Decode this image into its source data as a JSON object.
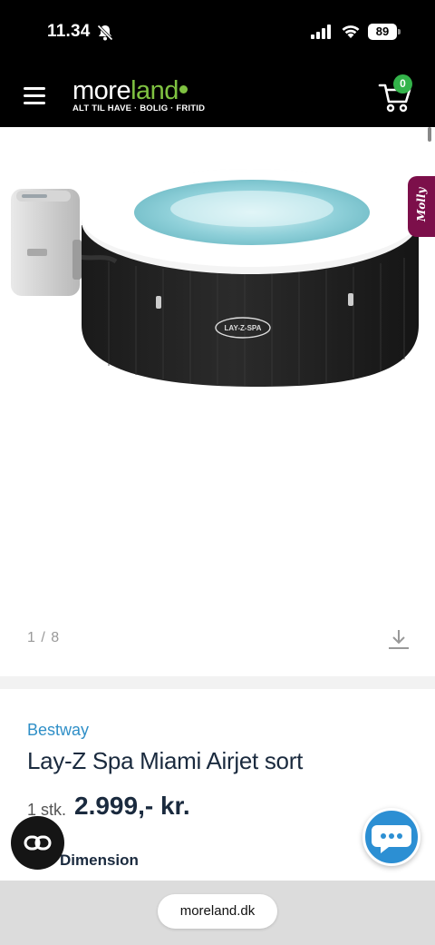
{
  "status_bar": {
    "time": "11.34",
    "battery": "89",
    "icons": [
      "bell-slash-icon",
      "signal-icon",
      "wifi-icon",
      "battery-icon"
    ]
  },
  "header": {
    "logo_text_white": "more",
    "logo_text_green": "land",
    "logo_tagline": "ALT TIL HAVE · BOLIG · FRITID",
    "cart_count": "0",
    "accent_color": "#7fc241",
    "badge_color": "#33b34a"
  },
  "gallery": {
    "pager": "1 / 8",
    "molly_label": "Molly",
    "product_brand_print": "LAY-Z-SPA"
  },
  "product": {
    "brand": "Bestway",
    "title": "Lay-Z Spa Miami Airjet sort",
    "quantity": "1 stk.",
    "price": "2.999,- kr.",
    "dimension_label": "Dimension"
  },
  "browser": {
    "url": "moreland.dk"
  }
}
